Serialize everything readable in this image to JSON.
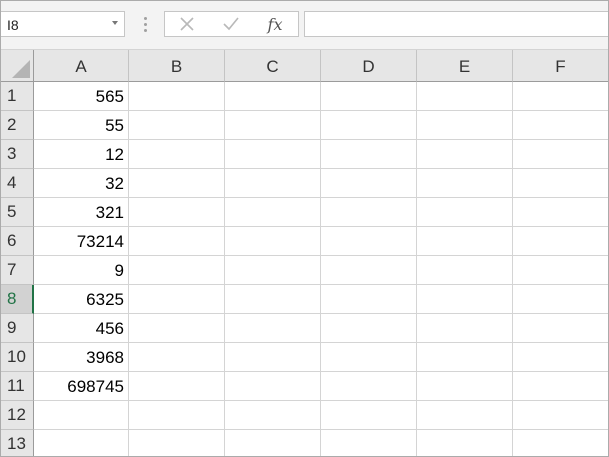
{
  "formula_bar": {
    "name_box": "I8",
    "cancel_icon": "x-icon",
    "enter_icon": "checkmark-icon",
    "function_label": "fx",
    "formula": ""
  },
  "grid": {
    "columns": [
      "A",
      "B",
      "C",
      "D",
      "E",
      "F"
    ],
    "rows": [
      {
        "num": "1",
        "A": "565"
      },
      {
        "num": "2",
        "A": "55"
      },
      {
        "num": "3",
        "A": "12"
      },
      {
        "num": "4",
        "A": "32"
      },
      {
        "num": "5",
        "A": "321"
      },
      {
        "num": "6",
        "A": "73214"
      },
      {
        "num": "7",
        "A": "9"
      },
      {
        "num": "8",
        "A": "6325"
      },
      {
        "num": "9",
        "A": "456"
      },
      {
        "num": "10",
        "A": "3968"
      },
      {
        "num": "11",
        "A": "698745"
      },
      {
        "num": "12",
        "A": ""
      },
      {
        "num": "13",
        "A": ""
      }
    ],
    "active_row": "8",
    "accent_color": "#217346"
  }
}
